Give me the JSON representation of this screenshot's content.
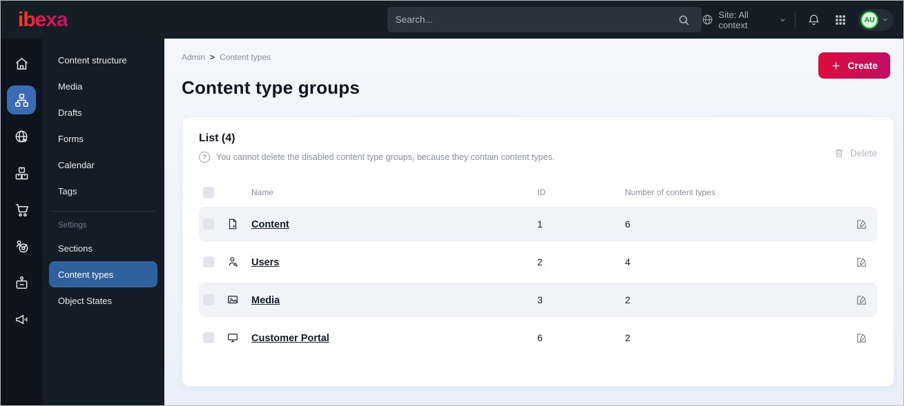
{
  "topbar": {
    "logo_text": "ibexa",
    "search_placeholder": "Search...",
    "site_context_label": "Site: All context",
    "avatar_initials": "AU"
  },
  "sidebar": {
    "rail_icons": [
      "home-icon",
      "content-tree-icon",
      "site-globe-icon",
      "products-icon",
      "cart-icon",
      "personalization-icon",
      "admin-badge-icon",
      "megaphone-icon"
    ],
    "menu_top": [
      "Content structure",
      "Media",
      "Drafts",
      "Forms",
      "Calendar",
      "Tags"
    ],
    "settings_label": "Settings",
    "menu_settings": [
      "Sections",
      "Content types",
      "Object States"
    ],
    "active_item": "Content types"
  },
  "main": {
    "breadcrumb": {
      "item1": "Admin",
      "separator": ">",
      "item2": "Content types"
    },
    "create_label": "Create",
    "page_title": "Content type groups",
    "list": {
      "title": "List (4)",
      "note": "You cannot delete the disabled content type groups, because they contain content types.",
      "delete_label": "Delete",
      "table": {
        "col_name": "Name",
        "col_id": "ID",
        "col_count": "Number of content types",
        "rows": [
          {
            "name": "Content",
            "id": "1",
            "count": "6",
            "icon": "file-icon"
          },
          {
            "name": "Users",
            "id": "2",
            "count": "4",
            "icon": "user-key-icon"
          },
          {
            "name": "Media",
            "id": "3",
            "count": "2",
            "icon": "image-icon"
          },
          {
            "name": "Customer Portal",
            "id": "6",
            "count": "2",
            "icon": "monitor-icon"
          }
        ]
      }
    }
  },
  "colors": {
    "accent_pink": "#db0853",
    "active_blue": "#35629e",
    "avatar_green": "#27a43c",
    "topbar_dark": "#151d27",
    "row_gray": "#f2f3f6"
  }
}
